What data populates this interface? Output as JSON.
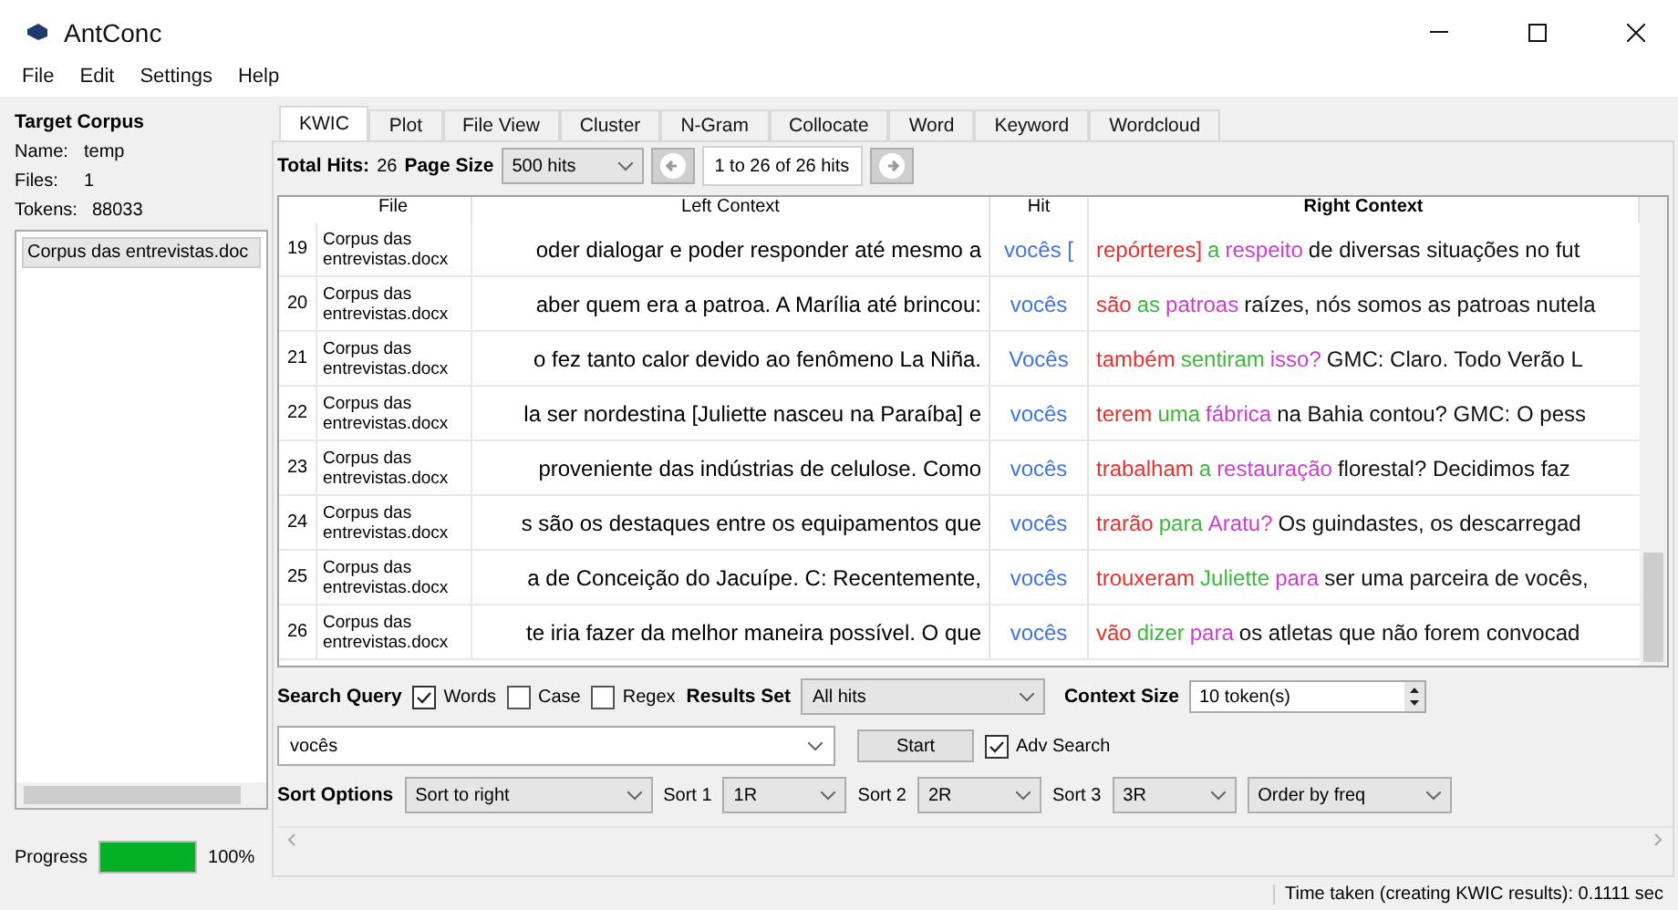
{
  "window": {
    "title": "AntConc"
  },
  "menu": [
    "File",
    "Edit",
    "Settings",
    "Help"
  ],
  "target_corpus": {
    "heading": "Target Corpus",
    "fields": [
      {
        "label": "Name:",
        "value": "temp"
      },
      {
        "label": "Files:",
        "value": "1"
      },
      {
        "label": "Tokens:",
        "value": "88033"
      }
    ],
    "files": [
      {
        "label": "Corpus das entrevistas.doc",
        "selected": true
      }
    ]
  },
  "progress": {
    "label": "Progress",
    "level": 1,
    "reading": "100%"
  },
  "tabs": [
    {
      "label": "KWIC",
      "selected": true
    },
    {
      "label": "Plot",
      "selected": false
    },
    {
      "label": "File View",
      "selected": false
    },
    {
      "label": "Cluster",
      "selected": false
    },
    {
      "label": "N-Gram",
      "selected": false
    },
    {
      "label": "Collocate",
      "selected": false
    },
    {
      "label": "Word",
      "selected": false
    },
    {
      "label": "Keyword",
      "selected": false
    },
    {
      "label": "Wordcloud",
      "selected": false
    }
  ],
  "hits_bar": {
    "total_label": "Total Hits:",
    "total": "26",
    "page_size_label": "Page Size",
    "page_size": "500 hits",
    "page_range": "1 to 26 of 26 hits"
  },
  "table": {
    "columns": [
      "File",
      "Left Context",
      "Hit",
      "Right Context"
    ],
    "rows": [
      {
        "number": "19",
        "file": "Corpus das entrevistas.docx",
        "left": "oder dialogar e poder responder até mesmo a",
        "hit": "vocês [",
        "right": [
          {
            "text": "repórteres]",
            "kind": "r1"
          },
          {
            "text": "a",
            "kind": "r2"
          },
          {
            "text": "respeito",
            "kind": "r3"
          },
          {
            "text": "de diversas situações no fut",
            "kind": "plain"
          }
        ]
      },
      {
        "number": "20",
        "file": "Corpus das entrevistas.docx",
        "left": "aber quem era a patroa. A Marília até brincou:",
        "hit": "vocês",
        "right": [
          {
            "text": "são",
            "kind": "r1"
          },
          {
            "text": "as",
            "kind": "r2"
          },
          {
            "text": "patroas",
            "kind": "r3"
          },
          {
            "text": "raízes, nós somos as patroas nutela",
            "kind": "plain"
          }
        ]
      },
      {
        "number": "21",
        "file": "Corpus das entrevistas.docx",
        "left": "o fez tanto calor devido ao fenômeno La Niña.",
        "hit": "Vocês",
        "right": [
          {
            "text": "também",
            "kind": "r1"
          },
          {
            "text": "sentiram",
            "kind": "r2"
          },
          {
            "text": "isso?",
            "kind": "r3"
          },
          {
            "text": "GMC: Claro. Todo Verão L",
            "kind": "plain"
          }
        ]
      },
      {
        "number": "22",
        "file": "Corpus das entrevistas.docx",
        "left": "la ser nordestina [Juliette nasceu na Paraíba] e",
        "hit": "vocês",
        "right": [
          {
            "text": "terem",
            "kind": "r1"
          },
          {
            "text": "uma",
            "kind": "r2"
          },
          {
            "text": "fábrica",
            "kind": "r3"
          },
          {
            "text": "na Bahia contou?  GMC: O pess",
            "kind": "plain"
          }
        ]
      },
      {
        "number": "23",
        "file": "Corpus das entrevistas.docx",
        "left": "proveniente das indústrias de celulose.   Como",
        "hit": "vocês",
        "right": [
          {
            "text": "trabalham",
            "kind": "r1"
          },
          {
            "text": "a",
            "kind": "r2"
          },
          {
            "text": "restauração",
            "kind": "r3"
          },
          {
            "text": "florestal?  Decidimos faz",
            "kind": "plain"
          }
        ]
      },
      {
        "number": "24",
        "file": "Corpus das entrevistas.docx",
        "left": "s são os destaques entre os equipamentos que",
        "hit": "vocês",
        "right": [
          {
            "text": "trarão",
            "kind": "r1"
          },
          {
            "text": "para",
            "kind": "r2"
          },
          {
            "text": "Aratu?",
            "kind": "r3"
          },
          {
            "text": "Os guindastes,  os descarregad",
            "kind": "plain"
          }
        ]
      },
      {
        "number": "25",
        "file": "Corpus das entrevistas.docx",
        "left": "a de Conceição do Jacuípe.   C: Recentemente,",
        "hit": "vocês",
        "right": [
          {
            "text": "trouxeram",
            "kind": "r1"
          },
          {
            "text": "Juliette",
            "kind": "r2"
          },
          {
            "text": "para",
            "kind": "r3"
          },
          {
            "text": "ser uma parceira de vocês,",
            "kind": "plain"
          }
        ]
      },
      {
        "number": "26",
        "file": "Corpus das entrevistas.docx",
        "left": "te iria fazer da melhor maneira possível. O que",
        "hit": "vocês",
        "right": [
          {
            "text": "vão",
            "kind": "r1"
          },
          {
            "text": "dizer",
            "kind": "r2"
          },
          {
            "text": "para",
            "kind": "r3"
          },
          {
            "text": "os atletas que não forem convocad",
            "kind": "plain"
          }
        ]
      }
    ]
  },
  "search": {
    "label": "Search Query",
    "options": [
      {
        "label": "Words",
        "checked": true
      },
      {
        "label": "Case",
        "checked": false
      },
      {
        "label": "Regex",
        "checked": false
      }
    ],
    "results_set_label": "Results Set",
    "results_set": "All hits",
    "context_size_label": "Context Size",
    "context_size": "10 token(s)",
    "query": "vocês",
    "start": "Start",
    "adv_search": {
      "label": "Adv Search",
      "checked": true
    }
  },
  "sort": {
    "label": "Sort Options",
    "mode": "Sort to right",
    "sorts": [
      {
        "label": "Sort 1",
        "value": "1R"
      },
      {
        "label": "Sort 2",
        "value": "2R"
      },
      {
        "label": "Sort 3",
        "value": "3R"
      }
    ],
    "order": "Order by freq"
  },
  "status": "Time taken (creating KWIC results):  0.1111 sec"
}
